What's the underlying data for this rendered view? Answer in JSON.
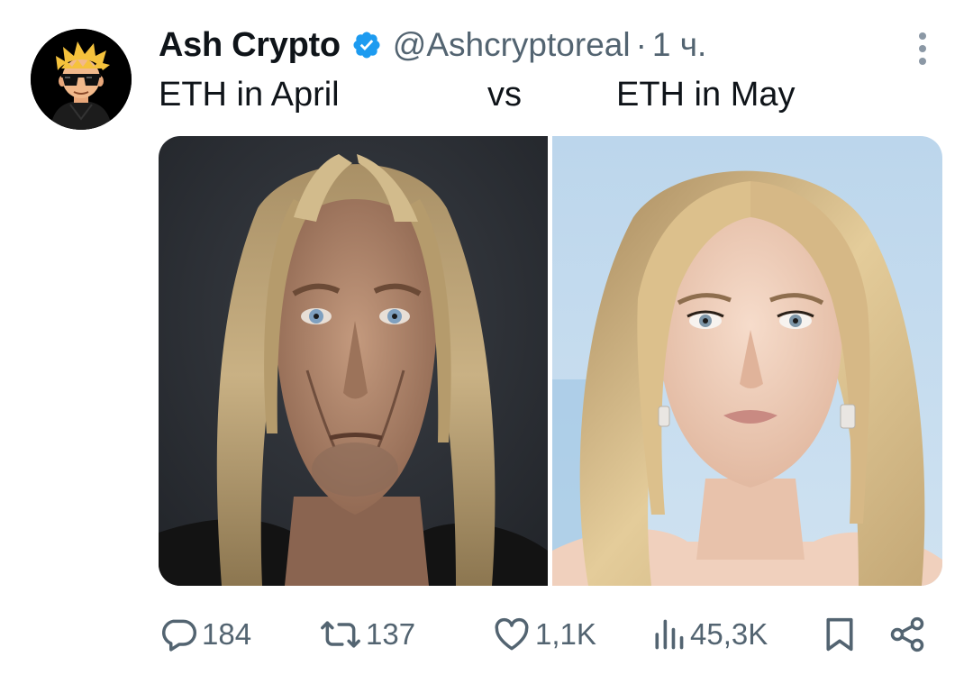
{
  "tweet": {
    "author": {
      "display_name": "Ash Crypto",
      "handle": "@Ashcryptoreal",
      "verified": true,
      "avatar_icon": "cartoon-avatar-sunglasses"
    },
    "separator": "·",
    "timestamp": "1 ч.",
    "text": {
      "left": "ETH in April",
      "middle": "vs",
      "right": "ETH in May"
    },
    "media": {
      "left_image": "portrait-older-man-long-blond-hair",
      "right_image": "portrait-young-woman-blond-hair"
    },
    "actions": {
      "replies": "184",
      "retweets": "137",
      "likes": "1,1K",
      "views": "45,3K"
    }
  },
  "colors": {
    "text_primary": "#0f1419",
    "text_secondary": "#536471",
    "verified_blue": "#1d9bf0",
    "background": "#ffffff"
  }
}
